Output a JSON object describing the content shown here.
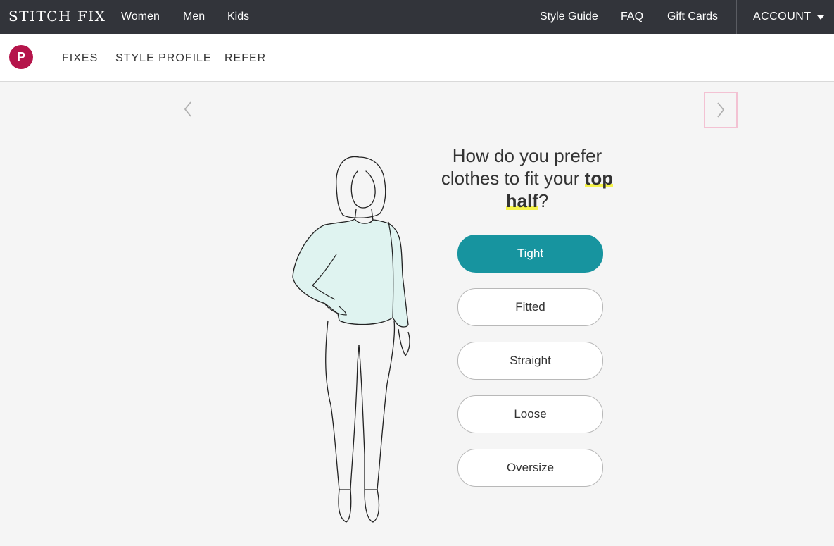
{
  "topbar": {
    "brand": "STITCH FIX",
    "left_links": [
      "Women",
      "Men",
      "Kids"
    ],
    "right_links": [
      "Style Guide",
      "FAQ",
      "Gift Cards"
    ],
    "account_label": "ACCOUNT"
  },
  "subnav": {
    "avatar_initial": "P",
    "links": [
      "FIXES",
      "STYLE PROFILE",
      "REFER"
    ]
  },
  "question": {
    "line_prefix": "How do you prefer clothes to fit your ",
    "highlight": "top half",
    "suffix": "?"
  },
  "options": [
    "Tight",
    "Fitted",
    "Straight",
    "Loose",
    "Oversize"
  ],
  "selected_option": "Tight",
  "colors": {
    "topbar_bg": "#32343a",
    "accent_teal": "#17949f",
    "avatar": "#b5154b",
    "highlight": "#f5f34a",
    "shirt": "#dff3f0"
  },
  "icons": {
    "prev": "chevron-left-icon",
    "next": "chevron-right-icon",
    "account": "caret-down-icon"
  }
}
